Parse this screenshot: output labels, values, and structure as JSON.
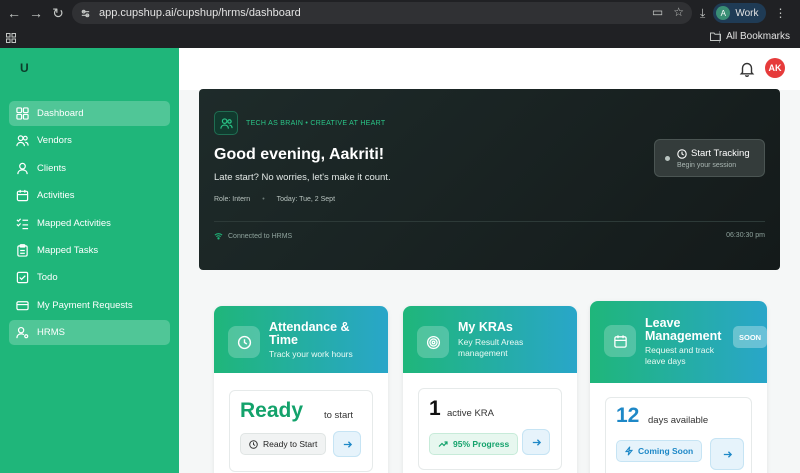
{
  "browser": {
    "url": "app.cupshup.ai/cupshup/hrms/dashboard",
    "profile_initial": "A",
    "profile_label": "Work",
    "all_bookmarks": "All Bookmarks"
  },
  "app": {
    "logo": "U"
  },
  "sidebar": {
    "items": [
      {
        "label": "Dashboard",
        "icon": "grid-icon",
        "active": true
      },
      {
        "label": "Vendors",
        "icon": "users-icon"
      },
      {
        "label": "Clients",
        "icon": "user-icon"
      },
      {
        "label": "Activities",
        "icon": "calendar-icon"
      },
      {
        "label": "Mapped Activities",
        "icon": "checklist-icon"
      },
      {
        "label": "Mapped Tasks",
        "icon": "clipboard-icon"
      },
      {
        "label": "Todo",
        "icon": "checkbox-icon"
      },
      {
        "label": "My Payment Requests",
        "icon": "card-icon"
      },
      {
        "label": "HRMS",
        "icon": "user-gear-icon",
        "active": true
      }
    ]
  },
  "header": {
    "avatar_initials": "AK"
  },
  "hero": {
    "tagline": "TECH AS BRAIN • CREATIVE AT HEART",
    "greeting": "Good evening, Aakriti!",
    "subtitle": "Late start? No worries, let's make it count.",
    "role": "Role: Intern",
    "date": "Today: Tue, 2 Sept",
    "connection": "Connected to HRMS",
    "time": "06:30:30 pm",
    "track_title": "Start Tracking",
    "track_sub": "Begin your session"
  },
  "cards": {
    "attendance": {
      "title_line1": "Attendance &",
      "title_line2": "Time",
      "subtitle": "Track your work hours",
      "big": "Ready",
      "suffix": "to start",
      "chip": "Ready to Start"
    },
    "kras": {
      "title": "My KRAs",
      "subtitle_line1": "Key Result Areas",
      "subtitle_line2": "management",
      "big": "1",
      "suffix": "active KRA",
      "chip": "95% Progress"
    },
    "leave": {
      "title_line1": "Leave",
      "title_line2": "Management",
      "subtitle_line1": "Request and track",
      "subtitle_line2": "leave days",
      "badge": "SOON",
      "big": "12",
      "suffix": "days available",
      "chip": "Coming Soon"
    }
  },
  "colors": {
    "sidebar": "#1fb67a",
    "accent_blue": "#29a6c9",
    "avatar": "#e63b3b"
  }
}
